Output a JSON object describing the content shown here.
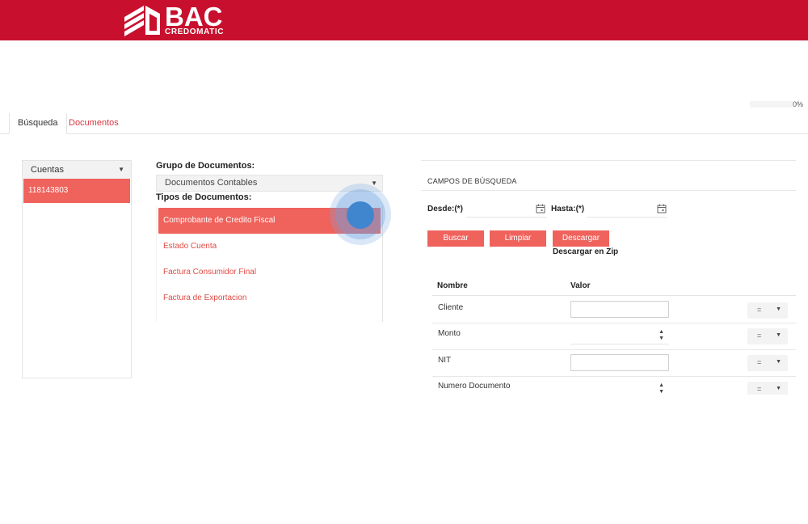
{
  "header": {
    "brand": "BAC",
    "brand_sub": "CREDOMATIC",
    "color": "#c8102e"
  },
  "progress": {
    "text": "0%",
    "value": 0
  },
  "tabs": [
    {
      "label": "Búsqueda",
      "active": true
    },
    {
      "label": "Documentos",
      "active": false
    }
  ],
  "accounts": {
    "select_label": "Cuentas",
    "items": [
      "118143803"
    ]
  },
  "documents": {
    "group_label": "Grupo de Documentos:",
    "group_value": "Documentos Contables",
    "types_label": "Tipos de Documentos:",
    "types": [
      {
        "label": "Comprobante de Credito Fiscal",
        "selected": true
      },
      {
        "label": "Estado Cuenta",
        "selected": false
      },
      {
        "label": "Factura Consumidor Final",
        "selected": false
      },
      {
        "label": "Factura de Exportacion",
        "selected": false
      }
    ]
  },
  "search": {
    "title": "CAMPOS DE BÚSQUEDA",
    "from_label": "Desde:(*)",
    "to_label": "Hasta:(*)",
    "buttons": {
      "search": "Buscar",
      "clear": "Limpiar",
      "download": "Descargar"
    },
    "zip_label": "Descargar en Zip",
    "columns": {
      "name": "Nombre",
      "value": "Valor"
    },
    "fields": [
      {
        "name": "Cliente",
        "operator": "="
      },
      {
        "name": "Monto",
        "operator": "="
      },
      {
        "name": "NIT",
        "operator": "="
      },
      {
        "name": "Numero Documento",
        "operator": "="
      }
    ]
  },
  "colors": {
    "accent": "#f0625c",
    "link": "#e04a44",
    "touch": "#3f86cf"
  }
}
